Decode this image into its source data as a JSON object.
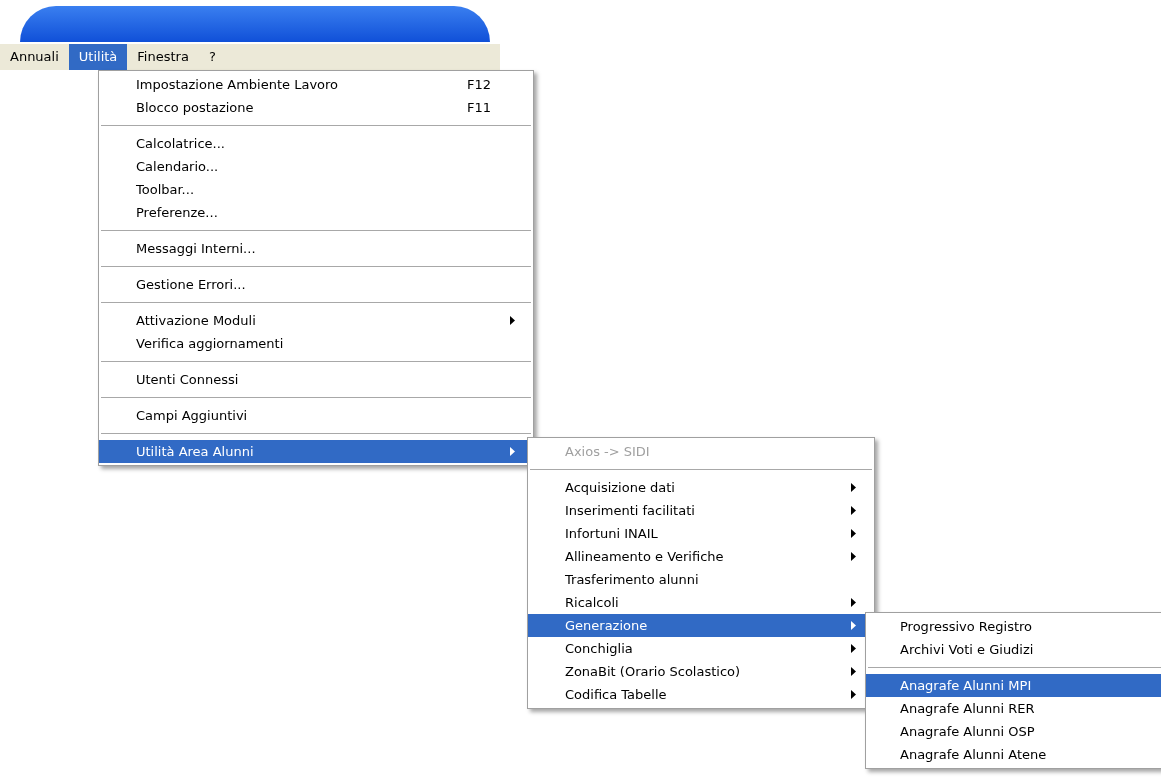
{
  "menubar": [
    {
      "label": "Annuali",
      "selected": false
    },
    {
      "label": "Utilità",
      "selected": true
    },
    {
      "label": "Finestra",
      "selected": false
    },
    {
      "label": "?",
      "selected": false
    }
  ],
  "menus": [
    {
      "groups": [
        [
          {
            "label": "Impostazione Ambiente Lavoro",
            "shortcut": "F12",
            "submenu": false,
            "selected": false,
            "disabled": false
          },
          {
            "label": "Blocco postazione",
            "shortcut": "F11",
            "submenu": false,
            "selected": false,
            "disabled": false
          }
        ],
        [
          {
            "label": "Calcolatrice...",
            "submenu": false,
            "selected": false,
            "disabled": false
          },
          {
            "label": "Calendario...",
            "submenu": false,
            "selected": false,
            "disabled": false
          },
          {
            "label": "Toolbar...",
            "submenu": false,
            "selected": false,
            "disabled": false
          },
          {
            "label": "Preferenze...",
            "submenu": false,
            "selected": false,
            "disabled": false
          }
        ],
        [
          {
            "label": "Messaggi Interni...",
            "submenu": false,
            "selected": false,
            "disabled": false
          }
        ],
        [
          {
            "label": "Gestione Errori...",
            "submenu": false,
            "selected": false,
            "disabled": false
          }
        ],
        [
          {
            "label": "Attivazione Moduli",
            "submenu": true,
            "selected": false,
            "disabled": false
          },
          {
            "label": "Verifica aggiornamenti",
            "submenu": false,
            "selected": false,
            "disabled": false
          }
        ],
        [
          {
            "label": "Utenti Connessi",
            "submenu": false,
            "selected": false,
            "disabled": false
          }
        ],
        [
          {
            "label": "Campi Aggiuntivi",
            "submenu": false,
            "selected": false,
            "disabled": false
          }
        ],
        [
          {
            "label": "Utilità Area Alunni",
            "submenu": true,
            "selected": true,
            "disabled": false
          }
        ]
      ]
    },
    {
      "groups": [
        [
          {
            "label": "Axios -> SIDI",
            "submenu": false,
            "selected": false,
            "disabled": true
          }
        ],
        [
          {
            "label": "Acquisizione dati",
            "submenu": true,
            "selected": false,
            "disabled": false
          },
          {
            "label": "Inserimenti facilitati",
            "submenu": true,
            "selected": false,
            "disabled": false
          },
          {
            "label": "Infortuni INAIL",
            "submenu": true,
            "selected": false,
            "disabled": false
          },
          {
            "label": "Allineamento e Verifiche",
            "submenu": true,
            "selected": false,
            "disabled": false
          },
          {
            "label": "Trasferimento alunni",
            "submenu": false,
            "selected": false,
            "disabled": false
          },
          {
            "label": "Ricalcoli",
            "submenu": true,
            "selected": false,
            "disabled": false
          },
          {
            "label": "Generazione",
            "submenu": true,
            "selected": true,
            "disabled": false
          },
          {
            "label": "Conchiglia",
            "submenu": true,
            "selected": false,
            "disabled": false
          },
          {
            "label": "ZonaBit (Orario Scolastico)",
            "submenu": true,
            "selected": false,
            "disabled": false
          },
          {
            "label": "Codifica Tabelle",
            "submenu": true,
            "selected": false,
            "disabled": false
          }
        ]
      ]
    },
    {
      "groups": [
        [
          {
            "label": "Progressivo Registro",
            "submenu": false,
            "selected": false,
            "disabled": false
          },
          {
            "label": "Archivi Voti e Giudizi",
            "submenu": false,
            "selected": false,
            "disabled": false
          }
        ],
        [
          {
            "label": "Anagrafe Alunni MPI",
            "submenu": false,
            "selected": true,
            "disabled": false
          },
          {
            "label": "Anagrafe Alunni RER",
            "submenu": false,
            "selected": false,
            "disabled": false
          },
          {
            "label": "Anagrafe Alunni OSP",
            "submenu": false,
            "selected": false,
            "disabled": false
          },
          {
            "label": "Anagrafe Alunni Atene",
            "submenu": false,
            "selected": false,
            "disabled": false
          }
        ]
      ]
    }
  ]
}
